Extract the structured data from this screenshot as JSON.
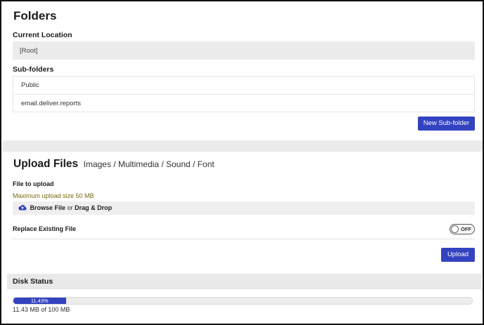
{
  "folders": {
    "title": "Folders",
    "current_location_label": "Current Location",
    "current_location_value": "[Root]",
    "subfolders_label": "Sub-folders",
    "subfolders": [
      "Public",
      "email.deliver.reports"
    ],
    "new_subfolder_button": "New Sub-folder"
  },
  "upload": {
    "title": "Upload Files",
    "types": "Images / Multimedia / Sound / Font",
    "file_to_upload_label": "File to upload",
    "max_size_text": "Maximum upload size 50 MB",
    "browse_text": "Browse File",
    "or_text": "or",
    "drag_text": "Drag & Drop",
    "replace_label": "Replace Existing File",
    "toggle_state": "OFF",
    "upload_button": "Upload"
  },
  "disk": {
    "title": "Disk Status",
    "percent_label": "11.43%",
    "used_fraction": 0.1143,
    "usage_text": "11.43 MB of 100 MB"
  },
  "colors": {
    "accent": "#3343c0",
    "hint_text": "#7a6a10"
  }
}
